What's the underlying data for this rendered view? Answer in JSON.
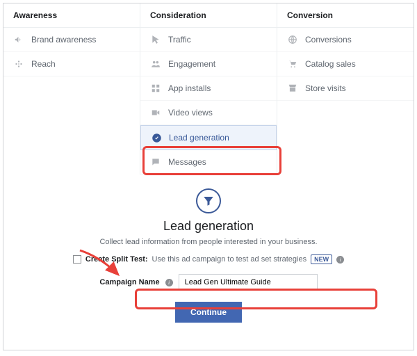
{
  "columns": {
    "awareness": {
      "header": "Awareness",
      "items": [
        "Brand awareness",
        "Reach"
      ]
    },
    "consideration": {
      "header": "Consideration",
      "items": [
        "Traffic",
        "Engagement",
        "App installs",
        "Video views",
        "Lead generation",
        "Messages"
      ]
    },
    "conversion": {
      "header": "Conversion",
      "items": [
        "Conversions",
        "Catalog sales",
        "Store visits"
      ]
    }
  },
  "selected": "Lead generation",
  "detail": {
    "title": "Lead generation",
    "subtitle": "Collect lead information from people interested in your business.",
    "split_label": "Create Split Test:",
    "split_desc": "Use this ad campaign to test ad set strategies",
    "new_badge": "NEW",
    "campaign_label": "Campaign Name",
    "campaign_value": "Lead Gen Ultimate Guide",
    "continue": "Continue"
  }
}
